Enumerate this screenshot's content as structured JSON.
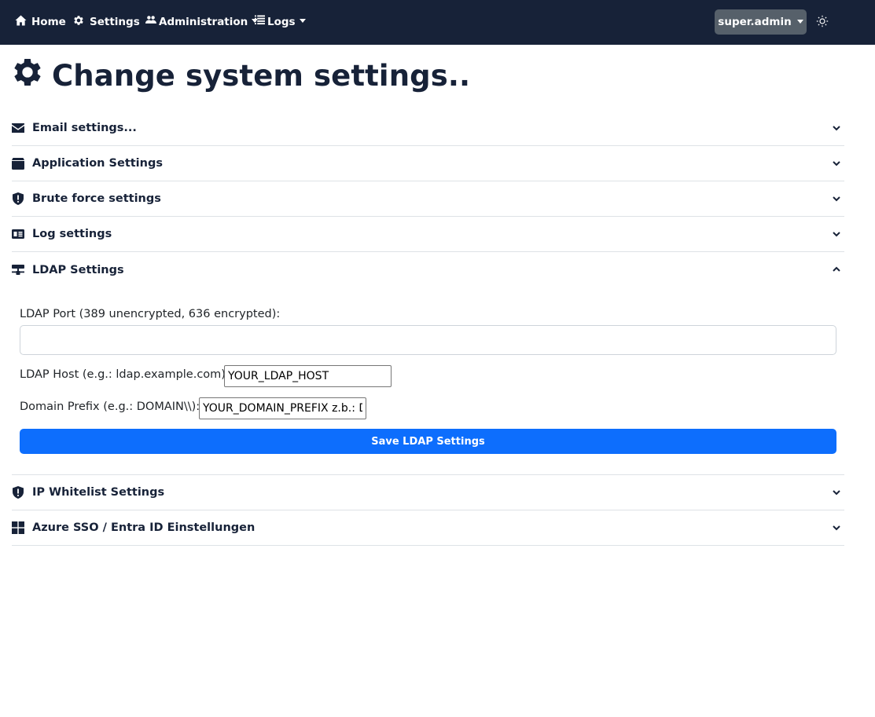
{
  "navbar": {
    "home_label": "Home",
    "settings_label": "Settings",
    "administration_label": "Administration",
    "logs_label": "Logs",
    "user_label": "super.admin"
  },
  "page": {
    "title": "Change system settings.."
  },
  "accordion": {
    "email": {
      "label": "Email settings...",
      "icon": "envelope-icon"
    },
    "application": {
      "label": "Application Settings",
      "icon": "box-icon"
    },
    "bruteforce": {
      "label": "Brute force settings",
      "icon": "shield-icon"
    },
    "log": {
      "label": "Log settings",
      "icon": "card-icon"
    },
    "ldap": {
      "label": "LDAP Settings",
      "icon": "network-icon",
      "expanded": true
    },
    "ipwhitelist": {
      "label": "IP Whitelist Settings",
      "icon": "shield-icon"
    },
    "azure": {
      "label": "Azure SSO / Entra ID Einstellungen",
      "icon": "windows-icon"
    }
  },
  "ldap_form": {
    "port_label": "LDAP Port (389 unencrypted, 636 encrypted):",
    "port_value": "",
    "host_label": "LDAP Host (e.g.: ldap.example.com):",
    "host_value": "YOUR_LDAP_HOST",
    "prefix_label": "Domain Prefix (e.g.: DOMAIN\\\\):",
    "prefix_value": "YOUR_DOMAIN_PREFIX z.b.: DOMAIN\\",
    "save_label": "Save LDAP Settings"
  },
  "colors": {
    "navbar_bg": "#172238",
    "primary": "#0d6efd",
    "user_button_bg": "#56606a"
  }
}
